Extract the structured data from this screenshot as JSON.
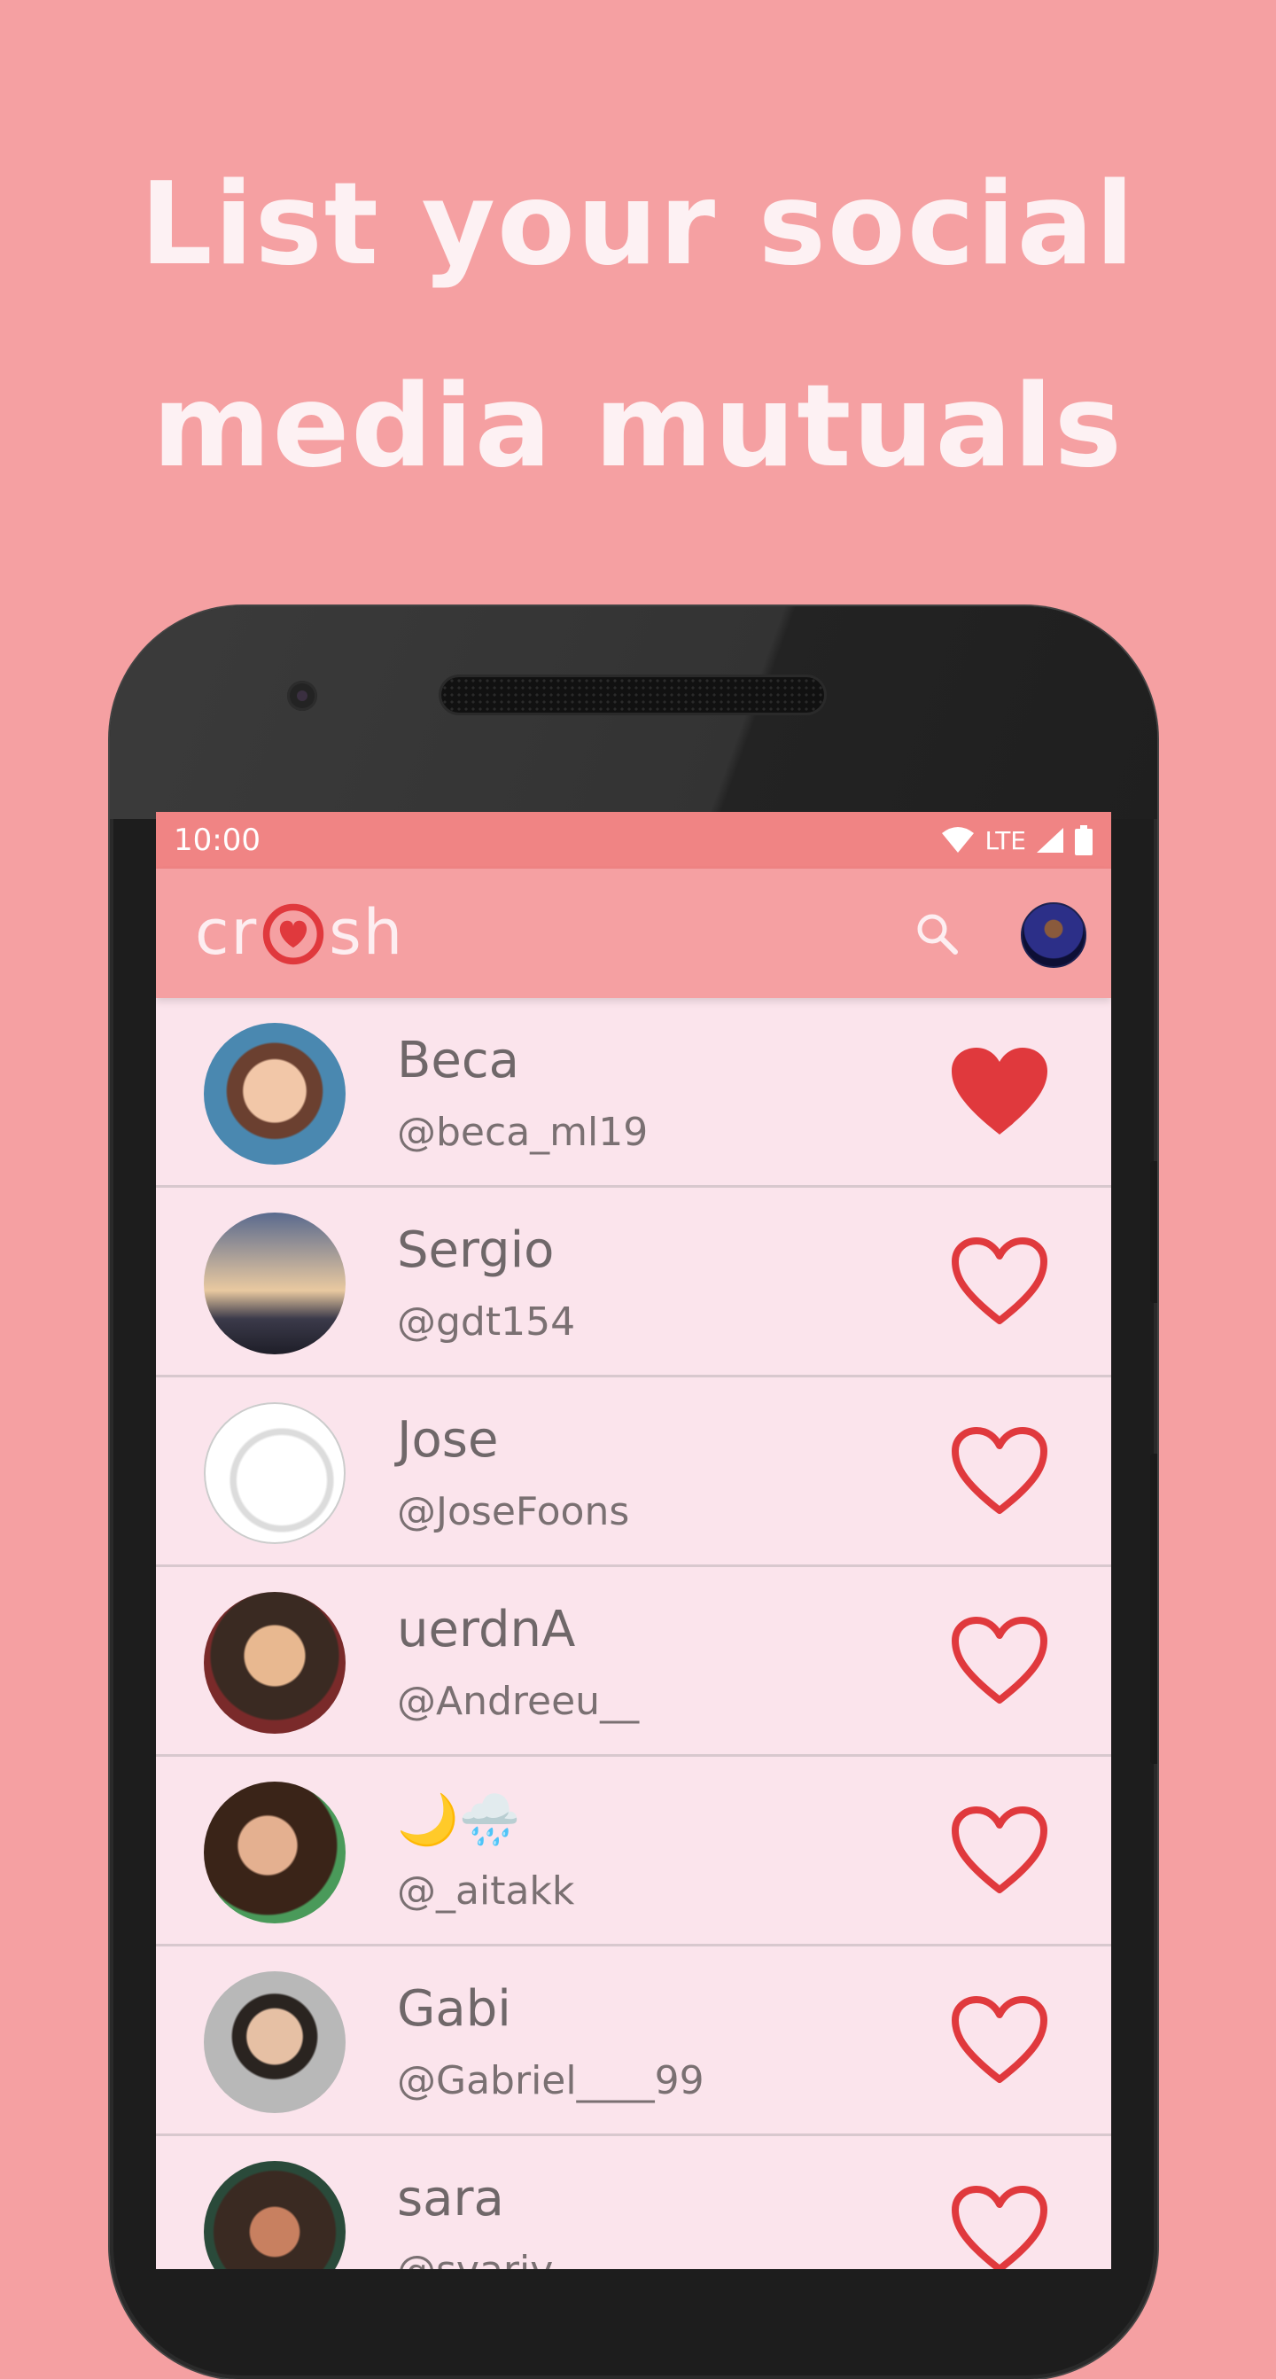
{
  "promo": {
    "line1": "List your social",
    "line2": "media mutuals"
  },
  "statusbar": {
    "time": "10:00",
    "network": "LTE"
  },
  "appbar": {
    "logo_left": "cr",
    "logo_right": "sh",
    "search_icon": "search-icon"
  },
  "colors": {
    "background": "#f5a0a2",
    "statusbar": "#f08484",
    "list_bg": "#fbe4ec",
    "heart": "#e0393d",
    "text": "#6f6769"
  },
  "users": [
    {
      "name": "Beca",
      "handle": "@beca_ml19",
      "liked": true
    },
    {
      "name": "Sergio",
      "handle": "@gdt154",
      "liked": false
    },
    {
      "name": "Jose",
      "handle": "@JoseFoons",
      "liked": false
    },
    {
      "name": "uerdnA",
      "handle": "@Andreeu__",
      "liked": false
    },
    {
      "name": "🌙🌧️",
      "handle": "@_aitakk",
      "liked": false
    },
    {
      "name": "Gabi",
      "handle": "@Gabriel____99",
      "liked": false
    },
    {
      "name": "sara",
      "handle": "@svariv",
      "liked": false
    }
  ]
}
